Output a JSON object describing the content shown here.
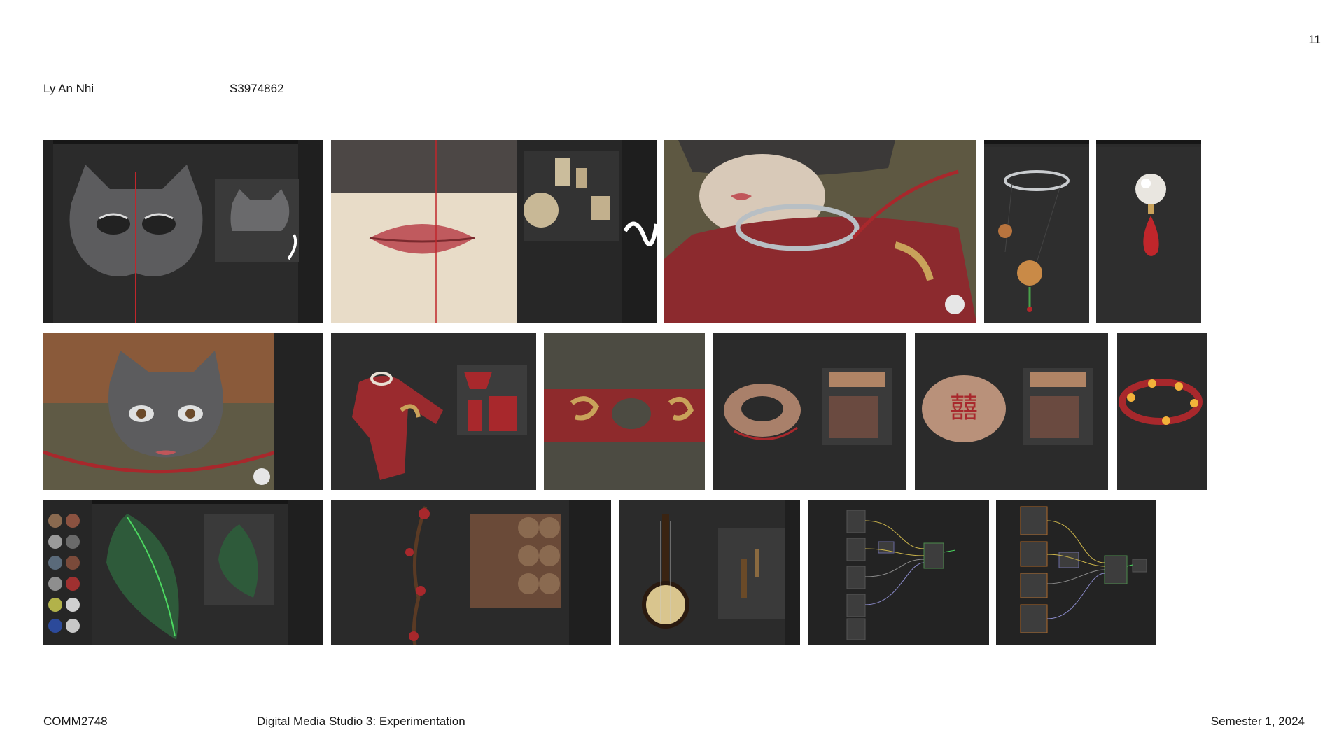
{
  "header": {
    "page_number": "11",
    "author_name": "Ly An Nhi",
    "student_id": "S3974862"
  },
  "footer": {
    "course_code": "COMM2748",
    "course_title": "Digital Media Studio 3: Experimentation",
    "semester": "Semester 1, 2024"
  },
  "colors": {
    "background": "#ffffff",
    "text": "#1a1a1a",
    "software_ui": "#2b2b2b",
    "accent_red": "#a8282c",
    "gold": "#c9a25a"
  },
  "screenshots": {
    "row1": [
      "mask-texture-painting",
      "lips-texture-painting",
      "character-neck-collar-render",
      "necklace-model",
      "pearl-earring-model"
    ],
    "row2": [
      "character-head-render",
      "red-garment-texture",
      "garment-pattern-closeup",
      "hat-brim-model",
      "hat-top-symbol",
      "flower-wreath-model"
    ],
    "row3": [
      "leaf-texture-painting",
      "branch-berries-texture",
      "lute-instrument-model",
      "shader-node-graph-1",
      "shader-node-graph-2"
    ]
  }
}
